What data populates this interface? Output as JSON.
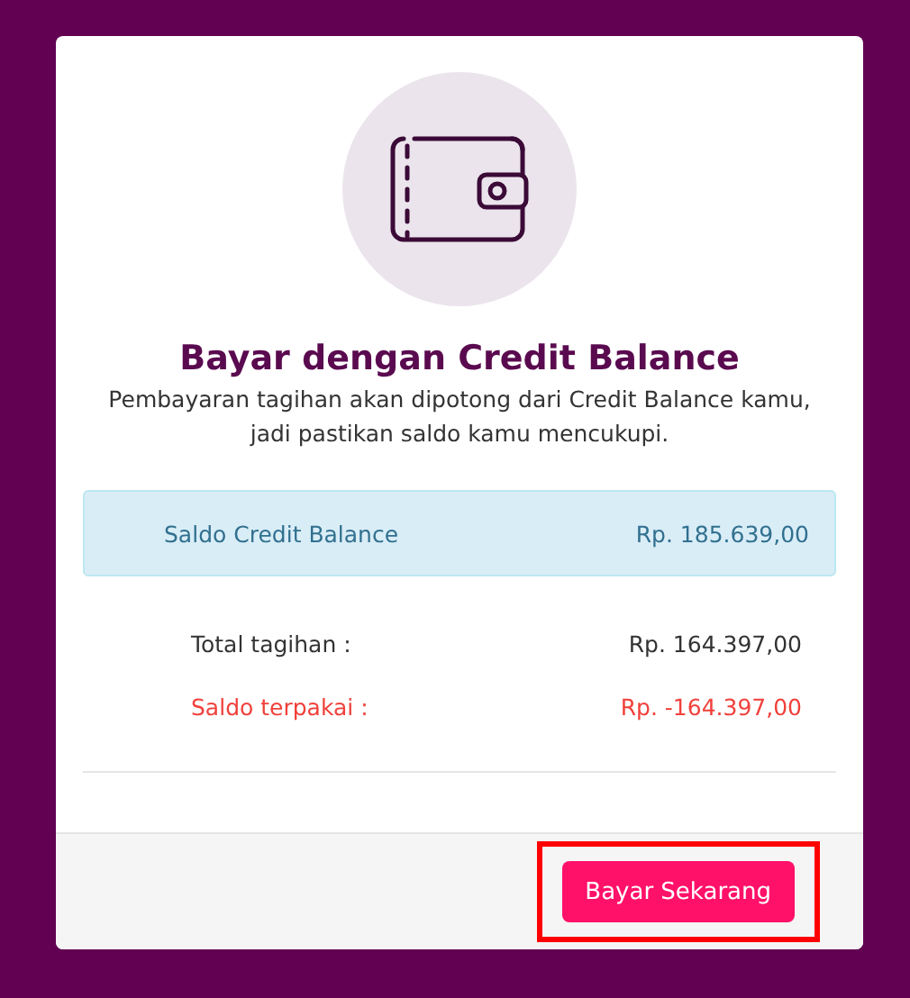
{
  "dialog": {
    "title": "Bayar dengan Credit Balance",
    "description": "Pembayaran tagihan akan dipotong dari Credit Balance kamu, jadi pastikan saldo kamu mencukupi.",
    "balance": {
      "label": "Saldo Credit Balance",
      "value": "Rp. 185.639,00"
    },
    "summary": [
      {
        "kind": "normal",
        "label": "Total tagihan :",
        "value": "Rp. 164.397,00"
      },
      {
        "kind": "warning",
        "label": "Saldo terpakai :",
        "value": "Rp. -164.397,00"
      }
    ],
    "button": {
      "label": "Bayar Sekarang",
      "highlighted": true
    }
  }
}
